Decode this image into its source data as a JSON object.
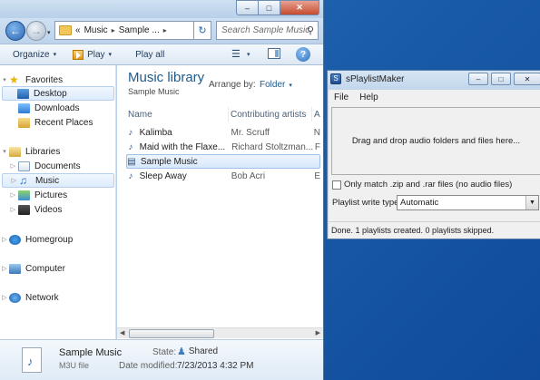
{
  "explorer": {
    "caption": {
      "min": "–",
      "max": "□",
      "close": "✕"
    },
    "address": {
      "chevron": "«",
      "segments": [
        "Music",
        "Sample ..."
      ],
      "sep": "▸",
      "dropdown": "▾"
    },
    "search_placeholder": "Search Sample Music",
    "toolbar": {
      "organize": "Organize",
      "play": "Play",
      "play_all": "Play all",
      "arrow": "▾"
    },
    "nav": [
      {
        "label": "Favorites",
        "icon": "star-icon",
        "twisty": ""
      },
      {
        "label": "Desktop",
        "icon": "desktop-icon",
        "selected": true
      },
      {
        "label": "Downloads",
        "icon": "downloads-icon"
      },
      {
        "label": "Recent Places",
        "icon": "recent-places-icon"
      },
      {
        "label": "Libraries",
        "icon": "libraries-icon"
      },
      {
        "label": "Documents",
        "icon": "documents-icon",
        "twisty": "▷"
      },
      {
        "label": "Music",
        "icon": "music-icon",
        "twisty": "▷",
        "selected": true
      },
      {
        "label": "Pictures",
        "icon": "pictures-icon",
        "twisty": "▷"
      },
      {
        "label": "Videos",
        "icon": "videos-icon",
        "twisty": "▷"
      },
      {
        "label": "Homegroup",
        "icon": "homegroup-icon",
        "twisty": "▷"
      },
      {
        "label": "Computer",
        "icon": "computer-icon",
        "twisty": "▷"
      },
      {
        "label": "Network",
        "icon": "network-icon",
        "twisty": "▷"
      }
    ],
    "main": {
      "title": "Music library",
      "subtitle": "Sample Music",
      "arrange_label": "Arrange by:",
      "arrange_value": "Folder",
      "columns": [
        "Name",
        "Contributing artists",
        "A"
      ],
      "rows": [
        {
          "name": "Kalimba",
          "artist": "Mr. Scruff",
          "extra": "N",
          "icon": "music-file-icon"
        },
        {
          "name": "Maid with the Flaxe...",
          "artist": "Richard Stoltzman...",
          "extra": "F",
          "icon": "music-file-icon"
        },
        {
          "name": "Sample Music",
          "artist": "",
          "extra": "",
          "icon": "playlist-file-icon",
          "selected": true
        },
        {
          "name": "Sleep Away",
          "artist": "Bob Acri",
          "extra": "E",
          "icon": "music-file-icon"
        }
      ]
    },
    "details": {
      "name": "Sample Music",
      "type": "M3U file",
      "state_label": "State:",
      "state_value": "Shared",
      "date_label": "Date modified:",
      "date_value": "7/23/2013 4:32 PM"
    }
  },
  "spm": {
    "title": "sPlaylistMaker",
    "caption": {
      "min": "–",
      "max": "□",
      "close": "✕"
    },
    "menu": [
      "File",
      "Help"
    ],
    "dropzone": "Drag and drop audio folders and files here...",
    "checkbox_label": "Only match .zip and .rar files (no audio files)",
    "type_label": "Playlist write types:",
    "type_value": "Automatic",
    "status": "Done.  1 playlists created.  0 playlists skipped."
  }
}
